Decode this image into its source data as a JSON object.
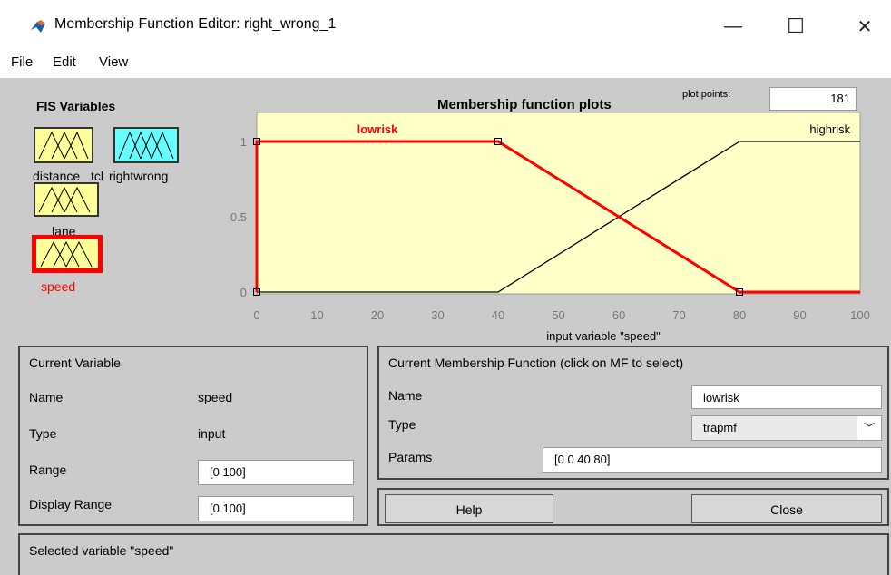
{
  "window": {
    "title": "Membership Function Editor: right_wrong_1",
    "minimize": "—",
    "maximize": "☐",
    "close": "✕"
  },
  "menu": {
    "items": [
      "File",
      "Edit",
      "View"
    ]
  },
  "fis_variables": {
    "title": "FIS Variables",
    "items": [
      {
        "label": "distance",
        "selected": false
      },
      {
        "label": "tcl",
        "selected": false
      },
      {
        "label": "rightwrong",
        "selected": false
      },
      {
        "label": "lane",
        "selected": false
      },
      {
        "label": "speed",
        "selected": true
      }
    ]
  },
  "plot": {
    "title": "Membership function plots",
    "plot_points_label": "plot points:",
    "plot_points_value": "181",
    "xlabel": "input variable \"speed\"",
    "x_ticks": [
      "0",
      "10",
      "20",
      "30",
      "40",
      "50",
      "60",
      "70",
      "80",
      "90",
      "100"
    ],
    "y_ticks": [
      "0",
      "0.5",
      "1"
    ]
  },
  "chart_data": {
    "type": "line",
    "xlabel": "input variable \"speed\"",
    "xlim": [
      0,
      100
    ],
    "ylim": [
      0,
      1
    ],
    "series": [
      {
        "name": "lowrisk",
        "x": [
          0,
          0,
          40,
          80,
          100
        ],
        "y": [
          0,
          1,
          1,
          0,
          0
        ],
        "color": "#ff0000",
        "selected": true
      },
      {
        "name": "highrisk",
        "x": [
          0,
          40,
          80,
          100
        ],
        "y": [
          0,
          0,
          1,
          1
        ],
        "color": "#000000",
        "selected": false
      }
    ]
  },
  "current_variable": {
    "header": "Current Variable",
    "name_label": "Name",
    "name_value": "speed",
    "type_label": "Type",
    "type_value": "input",
    "range_label": "Range",
    "range_value": "[0 100]",
    "display_range_label": "Display Range",
    "display_range_value": "[0 100]"
  },
  "current_mf": {
    "header": "Current Membership Function (click on MF to select)",
    "name_label": "Name",
    "name_value": "lowrisk",
    "type_label": "Type",
    "type_value": "trapmf",
    "params_label": "Params",
    "params_value": "[0 0 40 80]"
  },
  "buttons": {
    "help": "Help",
    "close": "Close"
  },
  "status": {
    "text": "Selected variable \"speed\""
  },
  "colors": {
    "panel_bg": "#cbcbcb",
    "plot_bg": "#ffffc8",
    "selected": "#ff0000",
    "mf_icon_fill": "#ffff99",
    "mf_icon_output": "#66ffff"
  }
}
